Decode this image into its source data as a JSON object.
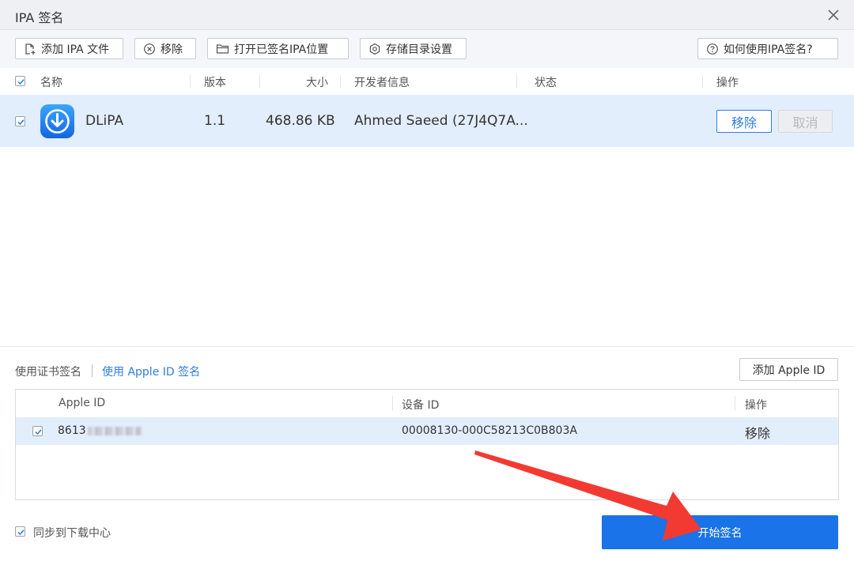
{
  "window": {
    "title": "IPA 签名"
  },
  "toolbar": {
    "add_ipa": "添加 IPA 文件",
    "remove": "移除",
    "open_signed": "打开已签名IPA位置",
    "storage_settings": "存储目录设置",
    "help": "如何使用IPA签名?"
  },
  "file_table": {
    "columns": {
      "name": "名称",
      "version": "版本",
      "size": "大小",
      "developer": "开发者信息",
      "status": "状态",
      "action": "操作"
    },
    "rows": [
      {
        "checked": true,
        "name": "DLiPA",
        "version": "1.1",
        "size": "468.86 KB",
        "developer": "Ahmed Saeed (27J4Q7A...",
        "status": "",
        "remove_label": "移除",
        "cancel_label": "取消"
      }
    ]
  },
  "signing": {
    "tab_cert": "使用证书签名",
    "tab_apple_id": "使用 Apple ID 签名",
    "add_apple_id": "添加 Apple ID",
    "columns": {
      "apple_id": "Apple ID",
      "device_id": "设备 ID",
      "action": "操作"
    },
    "rows": [
      {
        "checked": true,
        "apple_id_prefix": "8613",
        "device_id": "00008130-000C58213C0B803A",
        "remove_label": "移除"
      }
    ]
  },
  "footer": {
    "sync_label": "同步到下载中心",
    "sync_checked": true,
    "start_button": "开始签名"
  },
  "colors": {
    "accent": "#1a73e8",
    "selected_row": "#e3eefc",
    "annotation_arrow": "#f23a32"
  },
  "icons": {
    "close": "close-icon",
    "add_file": "add-file-icon",
    "remove": "circle-x-icon",
    "folder": "folder-icon",
    "settings": "gear-icon",
    "help": "help-circle-icon",
    "app": "download-arrow-icon"
  }
}
